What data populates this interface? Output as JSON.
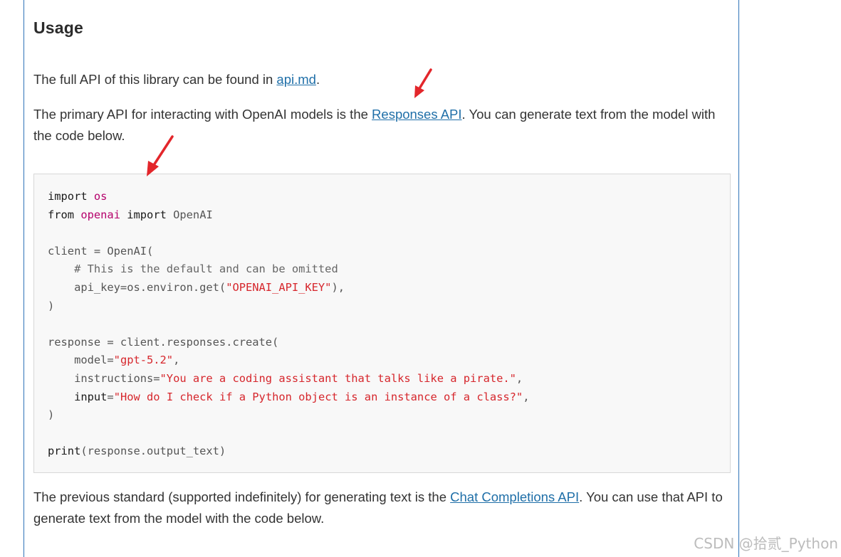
{
  "heading": "Usage",
  "para1": {
    "prefix": "The full API of this library can be found in ",
    "link": "api.md",
    "suffix": "."
  },
  "para2": {
    "prefix": "The primary API for interacting with OpenAI models is the ",
    "link": "Responses API",
    "suffix": ". You can generate text from the model with the code below."
  },
  "code": {
    "lines": [
      [
        {
          "t": "import",
          "c": "kw"
        },
        {
          "t": " "
        },
        {
          "t": "os",
          "c": "mod"
        }
      ],
      [
        {
          "t": "from",
          "c": "kw"
        },
        {
          "t": " "
        },
        {
          "t": "openai",
          "c": "mod"
        },
        {
          "t": " "
        },
        {
          "t": "import",
          "c": "kw"
        },
        {
          "t": " OpenAI"
        }
      ],
      [],
      [
        {
          "t": "client = OpenAI("
        }
      ],
      [
        {
          "t": "    "
        },
        {
          "t": "# This is the default and can be omitted",
          "c": "cm"
        }
      ],
      [
        {
          "t": "    api_key=os.environ.get("
        },
        {
          "t": "\"OPENAI_API_KEY\"",
          "c": "str"
        },
        {
          "t": "),"
        }
      ],
      [
        {
          "t": ")"
        }
      ],
      [],
      [
        {
          "t": "response = client.responses.create("
        }
      ],
      [
        {
          "t": "    model="
        },
        {
          "t": "\"gpt-5.2\"",
          "c": "str"
        },
        {
          "t": ","
        }
      ],
      [
        {
          "t": "    instructions="
        },
        {
          "t": "\"You are a coding assistant that talks like a pirate.\"",
          "c": "str"
        },
        {
          "t": ","
        }
      ],
      [
        {
          "t": "    "
        },
        {
          "t": "input",
          "c": "kw"
        },
        {
          "t": "="
        },
        {
          "t": "\"How do I check if a Python object is an instance of a class?\"",
          "c": "str"
        },
        {
          "t": ","
        }
      ],
      [
        {
          "t": ")"
        }
      ],
      [],
      [
        {
          "t": "print",
          "c": "kw"
        },
        {
          "t": "(response.output_text)"
        }
      ]
    ]
  },
  "para3": {
    "prefix": "The previous standard (supported indefinitely) for generating text is the ",
    "link": "Chat Completions API",
    "suffix": ". You can use that API to generate text from the model with the code below."
  },
  "annotations": {
    "arrow_color": "#e3262b"
  },
  "watermark": "CSDN @拾贰_Python"
}
